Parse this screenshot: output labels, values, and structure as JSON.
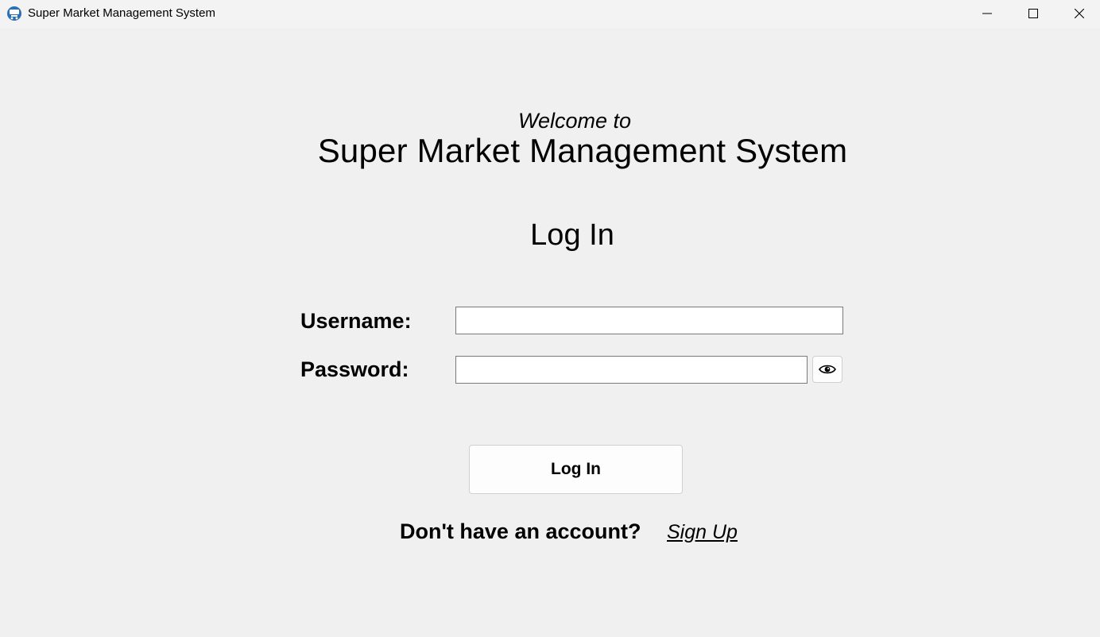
{
  "window": {
    "title": "Super Market Management System",
    "controls": {
      "minimize": "minimize-icon",
      "maximize": "maximize-icon",
      "close": "close-icon"
    }
  },
  "header": {
    "welcome": "Welcome to",
    "app_name": "Super Market Management System"
  },
  "login": {
    "heading": "Log In",
    "username_label": "Username:",
    "username_value": "",
    "password_label": "Password:",
    "password_value": "",
    "show_password_icon": "eye-icon",
    "submit_label": "Log In",
    "no_account_text": "Don't have an account?",
    "signup_link": "Sign Up"
  }
}
